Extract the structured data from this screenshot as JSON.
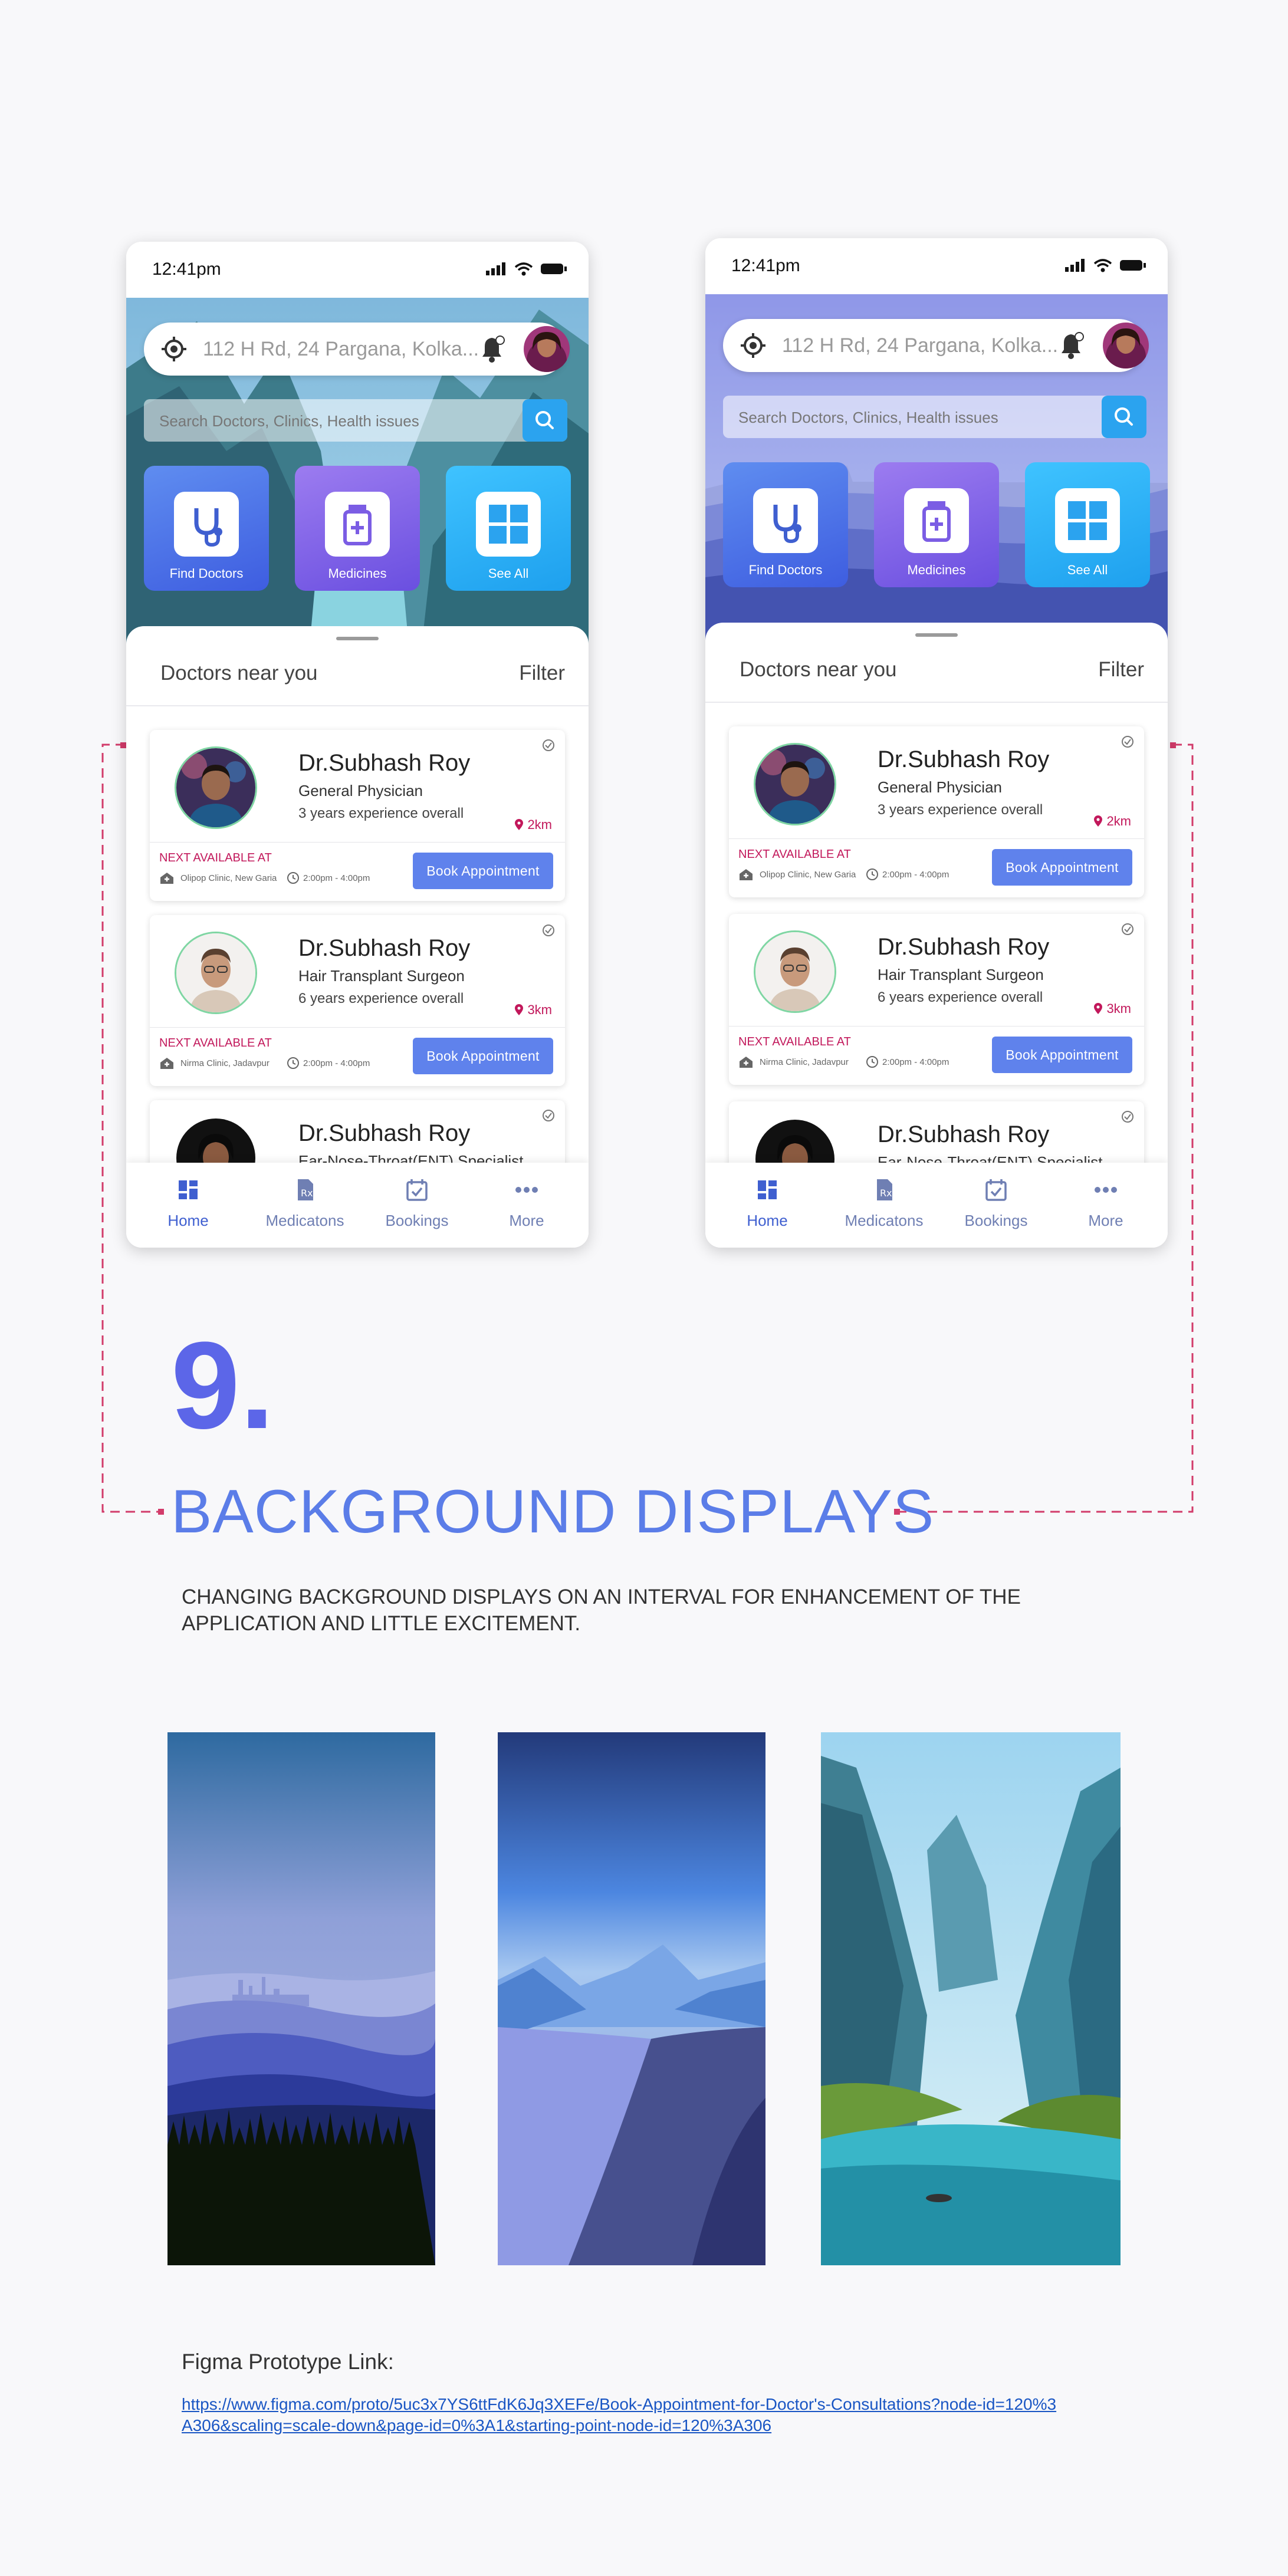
{
  "phones": [
    {
      "status_time": "12:41pm",
      "location": "112 H Rd, 24 Pargana, Kolka...",
      "search_placeholder": "Search Doctors, Clinics, Health issues",
      "categories": [
        "Find Doctors",
        "Medicines",
        "See All"
      ],
      "section_title": "Doctors near you",
      "filter_label": "Filter",
      "background": "mountain-valley",
      "doctors": [
        {
          "name": "Dr.Subhash Roy",
          "specialty": "General Physician",
          "experience": "3 years experience overall",
          "distance": "2km",
          "next_label": "NEXT AVAILABLE AT",
          "clinic": "Olipop Clinic, New Garia",
          "hours": "2:00pm - 4:00pm",
          "button": "Book Appointment"
        },
        {
          "name": "Dr.Subhash Roy",
          "specialty": "Hair Transplant Surgeon",
          "experience": "6 years experience overall",
          "distance": "3km",
          "next_label": "NEXT AVAILABLE AT",
          "clinic": "Nirma Clinic, Jadavpur",
          "hours": "2:00pm - 4:00pm",
          "button": "Book Appointment"
        },
        {
          "name": "Dr.Subhash Roy",
          "specialty": "Ear-Nose-Throat(ENT) Specialist"
        }
      ],
      "tabs": [
        "Home",
        "Medicatons",
        "Bookings",
        "More"
      ]
    },
    {
      "status_time": "12:41pm",
      "location": "112 H Rd, 24 Pargana, Kolka...",
      "search_placeholder": "Search Doctors, Clinics, Health issues",
      "categories": [
        "Find Doctors",
        "Medicines",
        "See All"
      ],
      "section_title": "Doctors near you",
      "filter_label": "Filter",
      "background": "blue-city-hills",
      "doctors": [
        {
          "name": "Dr.Subhash Roy",
          "specialty": "General Physician",
          "experience": "3 years experience overall",
          "distance": "2km",
          "next_label": "NEXT AVAILABLE AT",
          "clinic": "Olipop Clinic, New Garia",
          "hours": "2:00pm - 4:00pm",
          "button": "Book Appointment"
        },
        {
          "name": "Dr.Subhash Roy",
          "specialty": "Hair Transplant Surgeon",
          "experience": "6 years experience overall",
          "distance": "3km",
          "next_label": "NEXT AVAILABLE AT",
          "clinic": "Nirma Clinic, Jadavpur",
          "hours": "2:00pm - 4:00pm",
          "button": "Book Appointment"
        },
        {
          "name": "Dr.Subhash Roy",
          "specialty": "Ear-Nose-Throat(ENT) Specialist"
        }
      ],
      "tabs": [
        "Home",
        "Medicatons",
        "Bookings",
        "More"
      ]
    }
  ],
  "section": {
    "number": "9.",
    "heading": "BACKGROUND DISPLAYS",
    "description": "CHANGING BACKGROUND DISPLAYS ON AN INTERVAL FOR ENHANCEMENT OF THE APPLICATION AND LITTLE EXCITEMENT."
  },
  "backgrounds": [
    "blue-city-hills",
    "river-valley",
    "mountain-lake"
  ],
  "figma": {
    "label": "Figma Prototype Link:",
    "url": "https://www.figma.com/proto/5uc3x7YS6ttFdK6Jq3XEFe/Book-Appointment-for-Doctor's-Consultations?node-id=120%3A306&scaling=scale-down&page-id=0%3A1&starting-point-node-id=120%3A306"
  },
  "colors": {
    "accent": "#5f82ec",
    "heading_blue": "#5b7de8",
    "number_purple": "#5c66e8",
    "distance_pink": "#c2185b",
    "connector_pink": "#d23b6a"
  }
}
